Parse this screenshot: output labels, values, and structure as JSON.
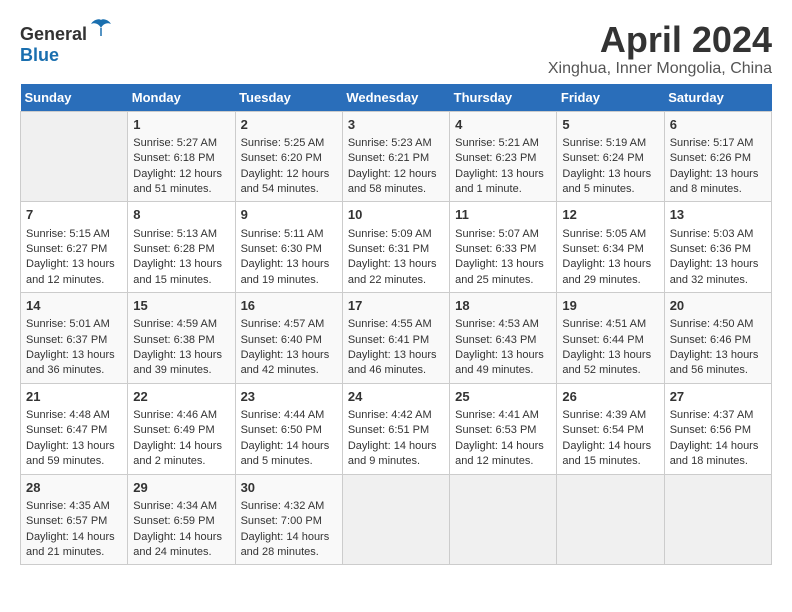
{
  "header": {
    "logo_general": "General",
    "logo_blue": "Blue",
    "title": "April 2024",
    "location": "Xinghua, Inner Mongolia, China"
  },
  "weekdays": [
    "Sunday",
    "Monday",
    "Tuesday",
    "Wednesday",
    "Thursday",
    "Friday",
    "Saturday"
  ],
  "weeks": [
    [
      {
        "day": "",
        "empty": true
      },
      {
        "day": "1",
        "sunrise": "Sunrise: 5:27 AM",
        "sunset": "Sunset: 6:18 PM",
        "daylight": "Daylight: 12 hours and 51 minutes."
      },
      {
        "day": "2",
        "sunrise": "Sunrise: 5:25 AM",
        "sunset": "Sunset: 6:20 PM",
        "daylight": "Daylight: 12 hours and 54 minutes."
      },
      {
        "day": "3",
        "sunrise": "Sunrise: 5:23 AM",
        "sunset": "Sunset: 6:21 PM",
        "daylight": "Daylight: 12 hours and 58 minutes."
      },
      {
        "day": "4",
        "sunrise": "Sunrise: 5:21 AM",
        "sunset": "Sunset: 6:23 PM",
        "daylight": "Daylight: 13 hours and 1 minute."
      },
      {
        "day": "5",
        "sunrise": "Sunrise: 5:19 AM",
        "sunset": "Sunset: 6:24 PM",
        "daylight": "Daylight: 13 hours and 5 minutes."
      },
      {
        "day": "6",
        "sunrise": "Sunrise: 5:17 AM",
        "sunset": "Sunset: 6:26 PM",
        "daylight": "Daylight: 13 hours and 8 minutes."
      }
    ],
    [
      {
        "day": "7",
        "sunrise": "Sunrise: 5:15 AM",
        "sunset": "Sunset: 6:27 PM",
        "daylight": "Daylight: 13 hours and 12 minutes."
      },
      {
        "day": "8",
        "sunrise": "Sunrise: 5:13 AM",
        "sunset": "Sunset: 6:28 PM",
        "daylight": "Daylight: 13 hours and 15 minutes."
      },
      {
        "day": "9",
        "sunrise": "Sunrise: 5:11 AM",
        "sunset": "Sunset: 6:30 PM",
        "daylight": "Daylight: 13 hours and 19 minutes."
      },
      {
        "day": "10",
        "sunrise": "Sunrise: 5:09 AM",
        "sunset": "Sunset: 6:31 PM",
        "daylight": "Daylight: 13 hours and 22 minutes."
      },
      {
        "day": "11",
        "sunrise": "Sunrise: 5:07 AM",
        "sunset": "Sunset: 6:33 PM",
        "daylight": "Daylight: 13 hours and 25 minutes."
      },
      {
        "day": "12",
        "sunrise": "Sunrise: 5:05 AM",
        "sunset": "Sunset: 6:34 PM",
        "daylight": "Daylight: 13 hours and 29 minutes."
      },
      {
        "day": "13",
        "sunrise": "Sunrise: 5:03 AM",
        "sunset": "Sunset: 6:36 PM",
        "daylight": "Daylight: 13 hours and 32 minutes."
      }
    ],
    [
      {
        "day": "14",
        "sunrise": "Sunrise: 5:01 AM",
        "sunset": "Sunset: 6:37 PM",
        "daylight": "Daylight: 13 hours and 36 minutes."
      },
      {
        "day": "15",
        "sunrise": "Sunrise: 4:59 AM",
        "sunset": "Sunset: 6:38 PM",
        "daylight": "Daylight: 13 hours and 39 minutes."
      },
      {
        "day": "16",
        "sunrise": "Sunrise: 4:57 AM",
        "sunset": "Sunset: 6:40 PM",
        "daylight": "Daylight: 13 hours and 42 minutes."
      },
      {
        "day": "17",
        "sunrise": "Sunrise: 4:55 AM",
        "sunset": "Sunset: 6:41 PM",
        "daylight": "Daylight: 13 hours and 46 minutes."
      },
      {
        "day": "18",
        "sunrise": "Sunrise: 4:53 AM",
        "sunset": "Sunset: 6:43 PM",
        "daylight": "Daylight: 13 hours and 49 minutes."
      },
      {
        "day": "19",
        "sunrise": "Sunrise: 4:51 AM",
        "sunset": "Sunset: 6:44 PM",
        "daylight": "Daylight: 13 hours and 52 minutes."
      },
      {
        "day": "20",
        "sunrise": "Sunrise: 4:50 AM",
        "sunset": "Sunset: 6:46 PM",
        "daylight": "Daylight: 13 hours and 56 minutes."
      }
    ],
    [
      {
        "day": "21",
        "sunrise": "Sunrise: 4:48 AM",
        "sunset": "Sunset: 6:47 PM",
        "daylight": "Daylight: 13 hours and 59 minutes."
      },
      {
        "day": "22",
        "sunrise": "Sunrise: 4:46 AM",
        "sunset": "Sunset: 6:49 PM",
        "daylight": "Daylight: 14 hours and 2 minutes."
      },
      {
        "day": "23",
        "sunrise": "Sunrise: 4:44 AM",
        "sunset": "Sunset: 6:50 PM",
        "daylight": "Daylight: 14 hours and 5 minutes."
      },
      {
        "day": "24",
        "sunrise": "Sunrise: 4:42 AM",
        "sunset": "Sunset: 6:51 PM",
        "daylight": "Daylight: 14 hours and 9 minutes."
      },
      {
        "day": "25",
        "sunrise": "Sunrise: 4:41 AM",
        "sunset": "Sunset: 6:53 PM",
        "daylight": "Daylight: 14 hours and 12 minutes."
      },
      {
        "day": "26",
        "sunrise": "Sunrise: 4:39 AM",
        "sunset": "Sunset: 6:54 PM",
        "daylight": "Daylight: 14 hours and 15 minutes."
      },
      {
        "day": "27",
        "sunrise": "Sunrise: 4:37 AM",
        "sunset": "Sunset: 6:56 PM",
        "daylight": "Daylight: 14 hours and 18 minutes."
      }
    ],
    [
      {
        "day": "28",
        "sunrise": "Sunrise: 4:35 AM",
        "sunset": "Sunset: 6:57 PM",
        "daylight": "Daylight: 14 hours and 21 minutes."
      },
      {
        "day": "29",
        "sunrise": "Sunrise: 4:34 AM",
        "sunset": "Sunset: 6:59 PM",
        "daylight": "Daylight: 14 hours and 24 minutes."
      },
      {
        "day": "30",
        "sunrise": "Sunrise: 4:32 AM",
        "sunset": "Sunset: 7:00 PM",
        "daylight": "Daylight: 14 hours and 28 minutes."
      },
      {
        "day": "",
        "empty": true
      },
      {
        "day": "",
        "empty": true
      },
      {
        "day": "",
        "empty": true
      },
      {
        "day": "",
        "empty": true
      }
    ]
  ]
}
